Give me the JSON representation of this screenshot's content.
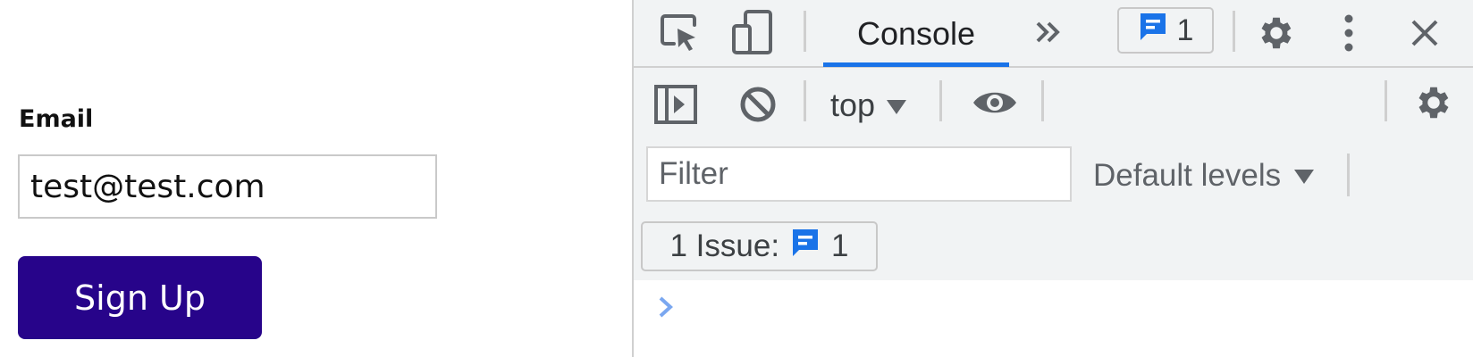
{
  "page": {
    "email_label": "Email",
    "email_value": "test@test.com",
    "signup_label": "Sign Up",
    "button_color": "#27048a"
  },
  "devtools": {
    "tabs": {
      "active_tab": "Console",
      "more_tabs_icon": "chevron-double-right-icon"
    },
    "issue_badge_count": "1",
    "context": "top",
    "filter_placeholder": "Filter",
    "levels_label": "Default levels",
    "issues_label": "1 Issue:",
    "issues_count": "1",
    "accent_color": "#1a73e8"
  }
}
